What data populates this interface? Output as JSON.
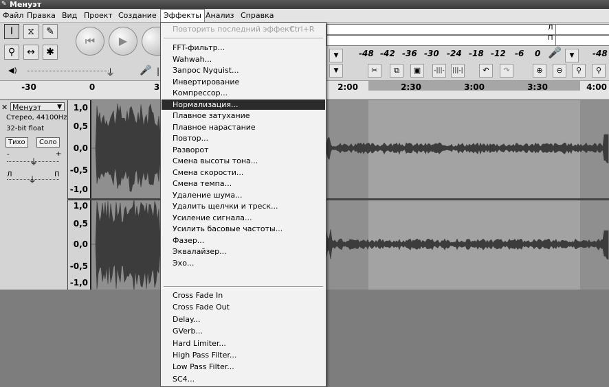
{
  "window": {
    "title": "Менуэт"
  },
  "menubar": [
    {
      "id": "file",
      "label": "Файл"
    },
    {
      "id": "edit",
      "label": "Правка"
    },
    {
      "id": "view",
      "label": "Вид"
    },
    {
      "id": "project",
      "label": "Проект"
    },
    {
      "id": "generate",
      "label": "Создание"
    },
    {
      "id": "effects",
      "label": "Эффекты",
      "active": true
    },
    {
      "id": "analyze",
      "label": "Анализ"
    },
    {
      "id": "help",
      "label": "Справка"
    }
  ],
  "effects_menu": {
    "repeat_last": {
      "label": "Повторить последний эффект",
      "shortcut": "Ctrl+R",
      "disabled": true
    },
    "builtin": [
      "FFT-фильтр...",
      "Wahwah...",
      "Запрос Nyquist...",
      "Инвертирование",
      "Компрессор...",
      "Нормализация...",
      "Плавное затухание",
      "Плавное нарастание",
      "Повтор...",
      "Разворот",
      "Смена высоты тона...",
      "Смена скорости...",
      "Смена темпа...",
      "Удаление шума...",
      "Удалить щелчки и треск...",
      "Усиление сигнала...",
      "Усилить басовые частоты...",
      "Фазер...",
      "Эквалайзер...",
      "Эхо..."
    ],
    "highlighted_index": 5,
    "plugins": [
      "Cross Fade In",
      "Cross Fade Out",
      "Delay...",
      "GVerb...",
      "Hard Limiter...",
      "High Pass Filter...",
      "Low Pass Filter...",
      "SC4..."
    ]
  },
  "meter": {
    "labels": [
      "-48",
      "-42",
      "-36",
      "-30",
      "-24",
      "-18",
      "-12",
      "-6",
      "0"
    ],
    "right_label": "-48",
    "right_letters": [
      "Л",
      "П"
    ]
  },
  "ruler": {
    "left_ticks": [
      "-30",
      "0",
      "3"
    ],
    "right_ticks": [
      "2:00",
      "2:30",
      "3:00",
      "3:30",
      "4:00"
    ]
  },
  "track": {
    "name": "Менуэт",
    "info_line1": "Стерео, 44100Hz",
    "info_line2": "32-bit float",
    "mute_label": "Тихо",
    "solo_label": "Соло",
    "gain_minus": "-",
    "gain_plus": "+",
    "pan_left": "Л",
    "pan_right": "П",
    "scale_values": [
      "1,0",
      "0,5",
      "0,0",
      "-0,5",
      "-1,0"
    ]
  },
  "colors": {
    "selection": "#a6a6a6",
    "menu_highlight": "#2b2b2b",
    "waveform": "#3c3c3c"
  }
}
